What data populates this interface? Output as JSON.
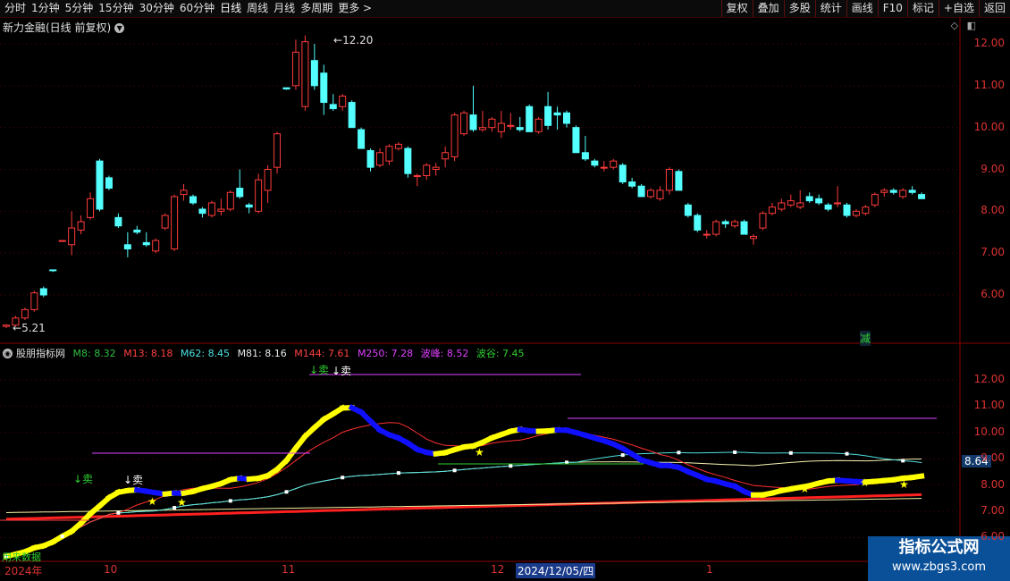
{
  "toolbar": {
    "left": [
      "分时",
      "1分钟",
      "5分钟",
      "15分钟",
      "30分钟",
      "60分钟",
      "日线",
      "周线",
      "月线",
      "多周期",
      "更多 >"
    ],
    "right": [
      "复权",
      "叠加",
      "多股",
      "统计",
      "画线",
      "F10",
      "标记",
      "+自选",
      "返回"
    ]
  },
  "main_chart": {
    "title": "新力金融(日线 前复权)",
    "settings_icon": "chevron-down-icon",
    "y_ticks": [
      "12.00",
      "11.00",
      "10.00",
      "9.00",
      "8.00",
      "7.00",
      "6.00"
    ],
    "high_label": "12.20",
    "low_label": "5.21",
    "signal_label": "减"
  },
  "indicator": {
    "name": "股朋指标网",
    "legend": [
      {
        "text": "M8: 8.32",
        "color": "#2fbf3f"
      },
      {
        "text": "M13: 8.18",
        "color": "#ff4040"
      },
      {
        "text": "M62: 8.45",
        "color": "#4fe0e0"
      },
      {
        "text": "M81: 8.16",
        "color": "#e8e8e8"
      },
      {
        "text": "M144: 7.61",
        "color": "#ff4040"
      },
      {
        "text": "M250: 7.28",
        "color": "#e040ff"
      },
      {
        "text": "波峰: 8.52",
        "color": "#e040ff"
      },
      {
        "text": "波谷: 7.45",
        "color": "#30d030"
      }
    ],
    "y_ticks": [
      "12.00",
      "11.00",
      "10.00",
      "9.00",
      "8.00",
      "7.00",
      "6.00"
    ],
    "current_value": "8.64",
    "sell_labels": [
      "↓卖",
      "↓卖",
      "↓卖",
      "↓卖"
    ],
    "bottom_note": "用来数据"
  },
  "date_axis": {
    "labels": [
      "2024年",
      "10",
      "11",
      "12",
      "2024/12/05/四",
      "1"
    ]
  },
  "candles": [
    {
      "o": 5.25,
      "h": 5.3,
      "l": 5.21,
      "c": 5.28
    },
    {
      "o": 5.28,
      "h": 5.5,
      "l": 5.25,
      "c": 5.45
    },
    {
      "o": 5.45,
      "h": 5.7,
      "l": 5.4,
      "c": 5.65
    },
    {
      "o": 5.65,
      "h": 6.1,
      "l": 5.6,
      "c": 6.05
    },
    {
      "o": 6.15,
      "h": 6.2,
      "l": 5.95,
      "c": 6.0
    },
    {
      "o": 6.6,
      "h": 6.6,
      "l": 6.55,
      "c": 6.58
    },
    {
      "o": 7.3,
      "h": 7.3,
      "l": 7.28,
      "c": 7.3
    },
    {
      "o": 7.2,
      "h": 8.0,
      "l": 6.95,
      "c": 7.6
    },
    {
      "o": 7.55,
      "h": 7.9,
      "l": 7.45,
      "c": 7.75
    },
    {
      "o": 7.85,
      "h": 8.45,
      "l": 7.8,
      "c": 8.3
    },
    {
      "o": 9.2,
      "h": 9.25,
      "l": 8.0,
      "c": 8.05
    },
    {
      "o": 8.8,
      "h": 8.85,
      "l": 8.5,
      "c": 8.55
    },
    {
      "o": 7.85,
      "h": 7.95,
      "l": 7.6,
      "c": 7.65
    },
    {
      "o": 7.2,
      "h": 7.5,
      "l": 6.9,
      "c": 7.1
    },
    {
      "o": 7.55,
      "h": 7.65,
      "l": 7.45,
      "c": 7.5
    },
    {
      "o": 7.25,
      "h": 7.5,
      "l": 7.15,
      "c": 7.2
    },
    {
      "o": 7.05,
      "h": 7.35,
      "l": 7.0,
      "c": 7.3
    },
    {
      "o": 7.6,
      "h": 7.95,
      "l": 7.55,
      "c": 7.9
    },
    {
      "o": 7.1,
      "h": 8.4,
      "l": 7.05,
      "c": 8.35
    },
    {
      "o": 8.4,
      "h": 8.65,
      "l": 8.25,
      "c": 8.5
    },
    {
      "o": 8.35,
      "h": 8.4,
      "l": 8.15,
      "c": 8.2
    },
    {
      "o": 8.05,
      "h": 8.1,
      "l": 7.85,
      "c": 7.95
    },
    {
      "o": 7.9,
      "h": 8.25,
      "l": 7.85,
      "c": 8.2
    },
    {
      "o": 8.0,
      "h": 8.3,
      "l": 7.9,
      "c": 8.05
    },
    {
      "o": 8.05,
      "h": 8.5,
      "l": 8.0,
      "c": 8.45
    },
    {
      "o": 8.55,
      "h": 9.0,
      "l": 8.3,
      "c": 8.35
    },
    {
      "o": 8.15,
      "h": 8.2,
      "l": 7.95,
      "c": 8.1
    },
    {
      "o": 8.0,
      "h": 8.9,
      "l": 7.95,
      "c": 8.75
    },
    {
      "o": 8.5,
      "h": 9.1,
      "l": 8.2,
      "c": 9.0
    },
    {
      "o": 9.05,
      "h": 9.9,
      "l": 8.9,
      "c": 9.85
    },
    {
      "o": 10.95,
      "h": 10.95,
      "l": 10.9,
      "c": 10.92
    },
    {
      "o": 11.0,
      "h": 12.1,
      "l": 10.9,
      "c": 11.8
    },
    {
      "o": 10.5,
      "h": 12.2,
      "l": 10.4,
      "c": 12.05
    },
    {
      "o": 11.6,
      "h": 12.0,
      "l": 10.9,
      "c": 11.0
    },
    {
      "o": 11.3,
      "h": 11.5,
      "l": 10.3,
      "c": 10.6
    },
    {
      "o": 10.55,
      "h": 10.8,
      "l": 10.4,
      "c": 10.45
    },
    {
      "o": 10.5,
      "h": 10.8,
      "l": 10.4,
      "c": 10.75
    },
    {
      "o": 10.6,
      "h": 10.65,
      "l": 10.0,
      "c": 10.0
    },
    {
      "o": 9.95,
      "h": 10.0,
      "l": 9.5,
      "c": 9.5
    },
    {
      "o": 9.45,
      "h": 9.5,
      "l": 8.95,
      "c": 9.05
    },
    {
      "o": 9.1,
      "h": 9.5,
      "l": 9.05,
      "c": 9.4
    },
    {
      "o": 9.2,
      "h": 9.6,
      "l": 9.1,
      "c": 9.55
    },
    {
      "o": 9.5,
      "h": 9.65,
      "l": 9.45,
      "c": 9.6
    },
    {
      "o": 9.5,
      "h": 9.55,
      "l": 8.8,
      "c": 8.9
    },
    {
      "o": 8.85,
      "h": 8.9,
      "l": 8.6,
      "c": 8.85
    },
    {
      "o": 8.85,
      "h": 9.15,
      "l": 8.75,
      "c": 9.1
    },
    {
      "o": 9.0,
      "h": 9.15,
      "l": 8.85,
      "c": 9.05
    },
    {
      "o": 9.25,
      "h": 9.55,
      "l": 9.05,
      "c": 9.4
    },
    {
      "o": 9.3,
      "h": 10.35,
      "l": 9.2,
      "c": 10.3
    },
    {
      "o": 9.85,
      "h": 10.4,
      "l": 9.8,
      "c": 10.35
    },
    {
      "o": 10.3,
      "h": 11.0,
      "l": 9.9,
      "c": 9.95
    },
    {
      "o": 9.95,
      "h": 10.4,
      "l": 9.9,
      "c": 10.0
    },
    {
      "o": 10.0,
      "h": 10.25,
      "l": 9.9,
      "c": 10.2
    },
    {
      "o": 9.9,
      "h": 10.4,
      "l": 9.75,
      "c": 10.1
    },
    {
      "o": 10.05,
      "h": 10.35,
      "l": 9.95,
      "c": 10.05
    },
    {
      "o": 10.0,
      "h": 10.25,
      "l": 9.9,
      "c": 9.95
    },
    {
      "o": 10.5,
      "h": 10.55,
      "l": 9.9,
      "c": 9.9
    },
    {
      "o": 9.9,
      "h": 10.25,
      "l": 9.85,
      "c": 10.2
    },
    {
      "o": 10.5,
      "h": 10.85,
      "l": 9.95,
      "c": 10.05
    },
    {
      "o": 10.35,
      "h": 10.5,
      "l": 9.95,
      "c": 10.3
    },
    {
      "o": 10.35,
      "h": 10.4,
      "l": 10.0,
      "c": 10.1
    },
    {
      "o": 10.0,
      "h": 10.05,
      "l": 9.4,
      "c": 9.4
    },
    {
      "o": 9.4,
      "h": 9.8,
      "l": 9.2,
      "c": 9.25
    },
    {
      "o": 9.2,
      "h": 9.25,
      "l": 9.05,
      "c": 9.1
    },
    {
      "o": 9.05,
      "h": 9.2,
      "l": 8.95,
      "c": 9.05
    },
    {
      "o": 9.05,
      "h": 9.25,
      "l": 9.0,
      "c": 9.2
    },
    {
      "o": 9.1,
      "h": 9.15,
      "l": 8.65,
      "c": 8.7
    },
    {
      "o": 8.7,
      "h": 8.8,
      "l": 8.55,
      "c": 8.6
    },
    {
      "o": 8.6,
      "h": 8.65,
      "l": 8.35,
      "c": 8.35
    },
    {
      "o": 8.35,
      "h": 8.55,
      "l": 8.3,
      "c": 8.5
    },
    {
      "o": 8.3,
      "h": 8.6,
      "l": 8.25,
      "c": 8.5
    },
    {
      "o": 8.5,
      "h": 9.05,
      "l": 8.4,
      "c": 9.0
    },
    {
      "o": 8.95,
      "h": 9.0,
      "l": 8.5,
      "c": 8.5
    },
    {
      "o": 8.15,
      "h": 8.2,
      "l": 7.85,
      "c": 7.9
    },
    {
      "o": 7.9,
      "h": 7.95,
      "l": 7.5,
      "c": 7.55
    },
    {
      "o": 7.45,
      "h": 7.55,
      "l": 7.35,
      "c": 7.45
    },
    {
      "o": 7.45,
      "h": 7.8,
      "l": 7.4,
      "c": 7.75
    },
    {
      "o": 7.75,
      "h": 7.8,
      "l": 7.6,
      "c": 7.7
    },
    {
      "o": 7.65,
      "h": 7.8,
      "l": 7.6,
      "c": 7.75
    },
    {
      "o": 7.75,
      "h": 7.8,
      "l": 7.45,
      "c": 7.45
    },
    {
      "o": 7.35,
      "h": 7.45,
      "l": 7.2,
      "c": 7.4
    },
    {
      "o": 7.6,
      "h": 8.0,
      "l": 7.55,
      "c": 7.95
    },
    {
      "o": 7.95,
      "h": 8.2,
      "l": 7.9,
      "c": 8.1
    },
    {
      "o": 8.05,
      "h": 8.3,
      "l": 8.0,
      "c": 8.2
    },
    {
      "o": 8.15,
      "h": 8.4,
      "l": 8.1,
      "c": 8.25
    },
    {
      "o": 8.1,
      "h": 8.5,
      "l": 8.05,
      "c": 8.2
    },
    {
      "o": 8.35,
      "h": 8.45,
      "l": 8.2,
      "c": 8.25
    },
    {
      "o": 8.3,
      "h": 8.4,
      "l": 8.15,
      "c": 8.2
    },
    {
      "o": 8.15,
      "h": 8.2,
      "l": 8.0,
      "c": 8.05
    },
    {
      "o": 8.2,
      "h": 8.6,
      "l": 8.1,
      "c": 8.2
    },
    {
      "o": 8.15,
      "h": 8.2,
      "l": 7.85,
      "c": 7.9
    },
    {
      "o": 7.9,
      "h": 8.05,
      "l": 7.85,
      "c": 8.0
    },
    {
      "o": 7.95,
      "h": 8.15,
      "l": 7.9,
      "c": 8.1
    },
    {
      "o": 8.15,
      "h": 8.45,
      "l": 8.1,
      "c": 8.4
    },
    {
      "o": 8.45,
      "h": 8.55,
      "l": 8.35,
      "c": 8.5
    },
    {
      "o": 8.5,
      "h": 8.55,
      "l": 8.4,
      "c": 8.45
    },
    {
      "o": 8.35,
      "h": 8.55,
      "l": 8.3,
      "c": 8.5
    },
    {
      "o": 8.5,
      "h": 8.6,
      "l": 8.4,
      "c": 8.45
    },
    {
      "o": 8.4,
      "h": 8.45,
      "l": 8.3,
      "c": 8.3
    }
  ],
  "colors": {
    "up": "#ff3b3b",
    "down": "#54ffff",
    "grid": "#5a0000"
  },
  "watermark": {
    "line1": "指标公式网",
    "line2": "www.zbgs3.com"
  }
}
